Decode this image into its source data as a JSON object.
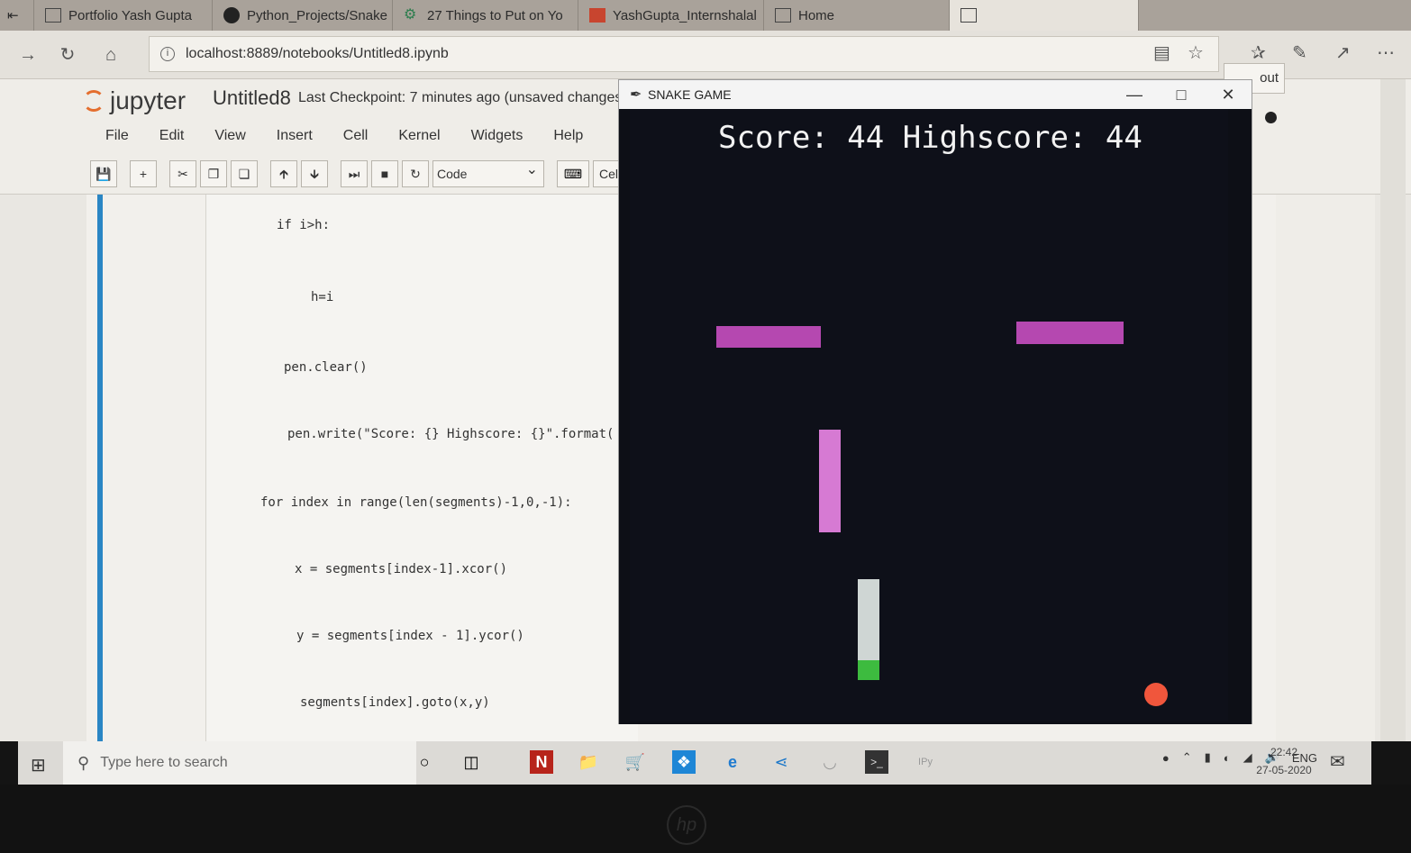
{
  "browser": {
    "tabs": [
      {
        "label": "Portfolio Yash Gupta",
        "icon": "page-icon"
      },
      {
        "label": "Python_Projects/Snake",
        "icon": "github-icon"
      },
      {
        "label": "27 Things to Put on Yo",
        "icon": "gear-icon"
      },
      {
        "label": "YashGupta_Internshalal",
        "icon": "internshala-icon"
      },
      {
        "label": "Home",
        "icon": "page-icon"
      }
    ],
    "address": "localhost:8889/notebooks/Untitled8.ipynb"
  },
  "jupyter": {
    "brand": "jupyter",
    "notebook_title": "Untitled8",
    "checkpoint": "Last Checkpoint: 7 minutes ago (unsaved changes)",
    "logout_label": "out",
    "menus": [
      "File",
      "Edit",
      "View",
      "Insert",
      "Cell",
      "Kernel",
      "Widgets",
      "Help"
    ],
    "cell_type": "Code",
    "cell_toolbar_label": "CellTo",
    "code_lines": [
      "if i>h:",
      "h=i",
      "pen.clear()",
      "pen.write(\"Score: {} Highscore: {}\".format(",
      "for index in range(len(segments)-1,0,-1):",
      "x = segments[index-1].xcor()",
      "y = segments[index - 1].ycor()",
      "segments[index].goto(x,y)"
    ]
  },
  "game": {
    "window_title": "SNAKE GAME",
    "score_line": "Score: 44 Highscore: 44",
    "colors": {
      "background": "#0e1019",
      "obstacle": "#b548b0",
      "obstacle_vertical": "#d67ad3",
      "snake_body": "#cfd6d4",
      "snake_head": "#3dbb3f",
      "food": "#f0563c",
      "score_text": "#f2f2f2"
    }
  },
  "taskbar": {
    "search_placeholder": "Type here to search",
    "language": "ENG",
    "time": "22:42",
    "date": "27-05-2020"
  }
}
